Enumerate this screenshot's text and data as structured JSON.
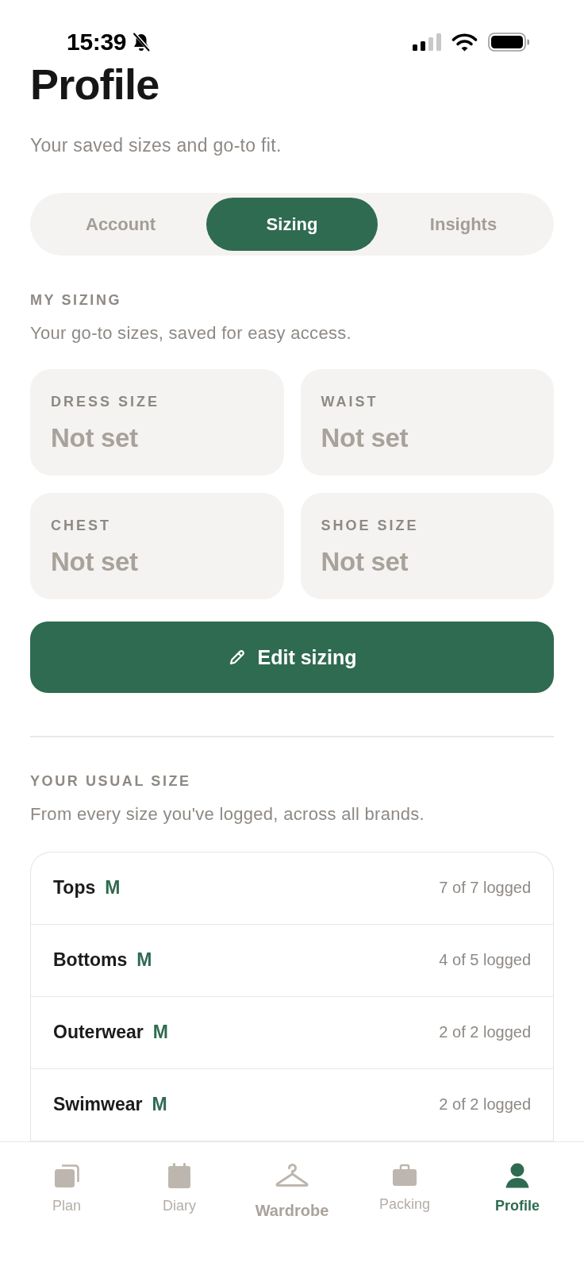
{
  "status_bar": {
    "time": "15:39"
  },
  "header": {
    "title": "Profile",
    "subtitle": "Your saved sizes and go-to fit."
  },
  "tabs": [
    {
      "label": "Account",
      "selected": false
    },
    {
      "label": "Sizing",
      "selected": true
    },
    {
      "label": "Insights",
      "selected": false
    }
  ],
  "my_sizing": {
    "heading": "MY SIZING",
    "description": "Your go-to sizes, saved for easy access.",
    "fields": [
      {
        "label": "DRESS SIZE",
        "value": "Not set"
      },
      {
        "label": "WAIST",
        "value": "Not set"
      },
      {
        "label": "CHEST",
        "value": "Not set"
      },
      {
        "label": "SHOE SIZE",
        "value": "Not set"
      }
    ],
    "button": {
      "label": "Edit sizing"
    }
  },
  "usual_size": {
    "heading": "YOUR USUAL SIZE",
    "description": "From every size you've logged, across all brands.",
    "rows": [
      {
        "category": "Tops",
        "size": "M",
        "count": "7 of 7 logged"
      },
      {
        "category": "Bottoms",
        "size": "M",
        "count": "4 of 5 logged"
      },
      {
        "category": "Outerwear",
        "size": "M",
        "count": "2 of 2 logged"
      },
      {
        "category": "Swimwear",
        "size": "M",
        "count": "2 of 2 logged"
      }
    ]
  },
  "bottom_nav": [
    {
      "label": "Plan",
      "kind": "tab",
      "selected": false
    },
    {
      "label": "Diary",
      "kind": "tab",
      "selected": false
    },
    {
      "label": "Wardrobe",
      "kind": "center",
      "selected": false
    },
    {
      "label": "Packing",
      "kind": "tab",
      "selected": false
    },
    {
      "label": "Profile",
      "kind": "tab",
      "selected": true
    }
  ]
}
